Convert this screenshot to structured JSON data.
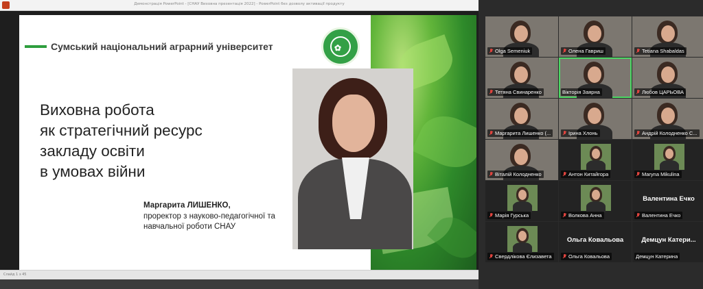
{
  "presentation": {
    "window_title": "Демонстрація PowerPoint - [СНАУ Виховна презентація 2022] - PowerPoint без дозволу активації продукту",
    "status_text": "Слайд 1 з 45",
    "slide": {
      "university": "Сумський національний аграрний університет",
      "title_lines": [
        "Виховна робота",
        "як стратегічний ресурс",
        "закладу освіти",
        "в умовах війни"
      ],
      "speaker_name": "Маргарита ЛИШЕНКО,",
      "speaker_role_lines": [
        "проректор з науково-педагогічної та",
        "навчальної роботи СНАУ"
      ]
    }
  },
  "gallery": {
    "participants": [
      {
        "name": "Olga Semeniuk",
        "video": true,
        "muted": true
      },
      {
        "name": "Олена Гавриш",
        "video": true,
        "muted": true
      },
      {
        "name": "Tetiana Shabaldas",
        "video": true,
        "muted": true
      },
      {
        "name": "Тетяна Свинаренко",
        "video": true,
        "muted": true
      },
      {
        "name": "Вікторія Заярна",
        "video": true,
        "muted": false,
        "active": true
      },
      {
        "name": "Любов ЦАРЬОВА",
        "video": true,
        "muted": true
      },
      {
        "name": "Маргарита Лишенко (...",
        "video": true,
        "muted": true
      },
      {
        "name": "Ірина Хлонь",
        "video": true,
        "muted": true
      },
      {
        "name": "Андрій Колодненко С...",
        "video": true,
        "muted": true
      },
      {
        "name": "Віталій Колодненко",
        "video": true,
        "muted": true
      },
      {
        "name": "Антон Китайгора",
        "video": false,
        "avatar": true,
        "muted": true
      },
      {
        "name": "Maryna Mikulina",
        "video": false,
        "avatar": true,
        "muted": true
      },
      {
        "name": "Марія Гурська",
        "video": false,
        "avatar": true,
        "muted": true
      },
      {
        "name": "Волкова Анна",
        "video": false,
        "avatar": true,
        "muted": true
      },
      {
        "name": "Валентина Ечко",
        "video": false,
        "big_name": "Валентина Ечко",
        "muted": true
      },
      {
        "name": "Свердлікова Єлизавета",
        "video": false,
        "avatar": true,
        "muted": true
      },
      {
        "name": "Ольга Ковальова",
        "video": false,
        "big_name": "Ольга Ковальова",
        "muted": true
      },
      {
        "name": "Демцун Катерина",
        "video": false,
        "big_name": "Демцун Катери...",
        "muted": false
      }
    ]
  }
}
